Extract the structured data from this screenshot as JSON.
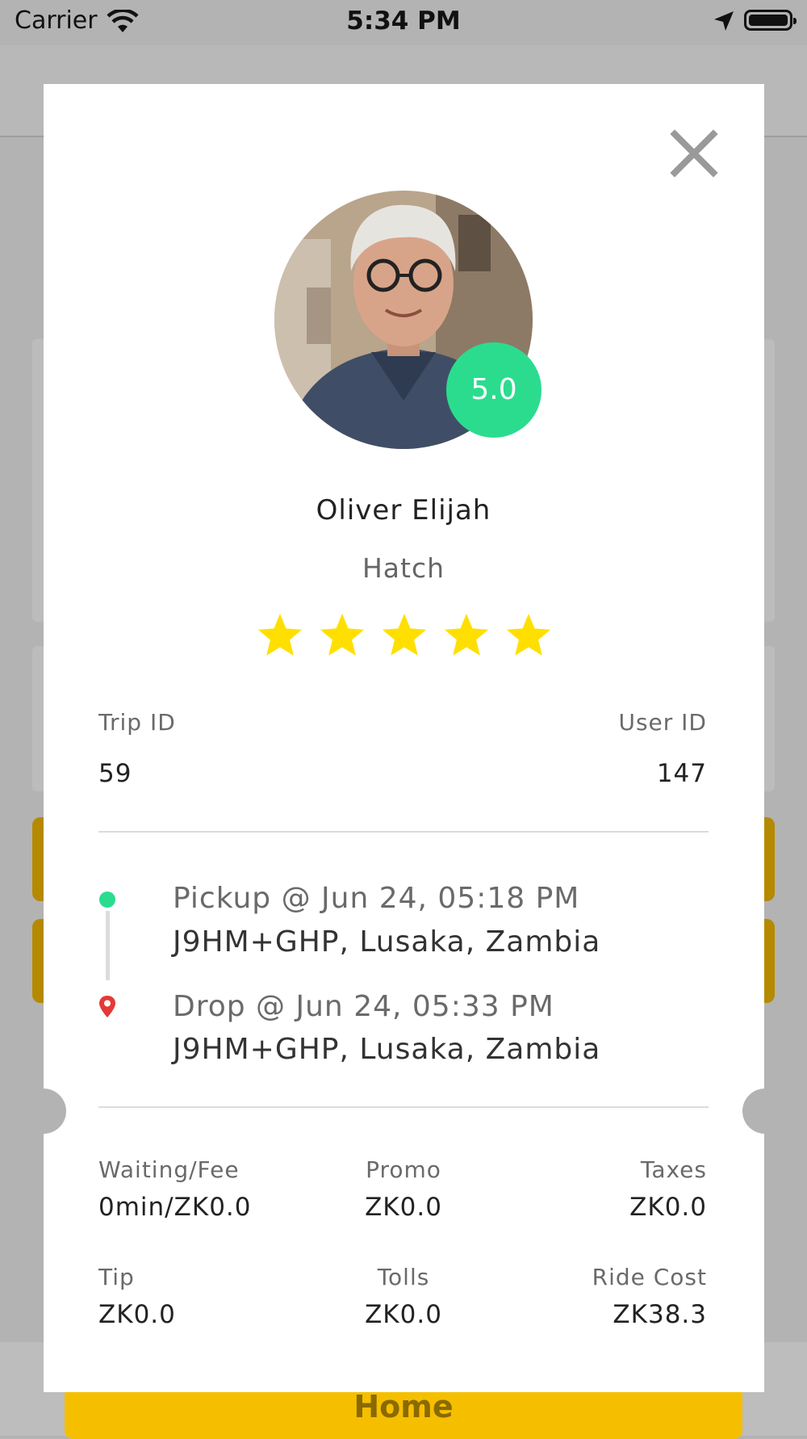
{
  "status_bar": {
    "carrier": "Carrier",
    "time": "5:34 PM"
  },
  "background": {
    "home_button": "Home"
  },
  "modal": {
    "rating": "5.0",
    "driver_name": "Oliver Elijah",
    "vehicle": "Hatch",
    "stars": 5,
    "trip_id_label": "Trip ID",
    "trip_id": "59",
    "user_id_label": "User ID",
    "user_id": "147",
    "pickup": {
      "title": "Pickup @ Jun 24, 05:18 PM",
      "address": "J9HM+GHP, Lusaka, Zambia"
    },
    "drop": {
      "title": "Drop @ Jun 24, 05:33 PM",
      "address": "J9HM+GHP, Lusaka, Zambia"
    },
    "fees": {
      "waiting_label": "Waiting/Fee",
      "waiting_value": "0min/ZK0.0",
      "promo_label": "Promo",
      "promo_value": "ZK0.0",
      "taxes_label": "Taxes",
      "taxes_value": "ZK0.0",
      "tip_label": "Tip",
      "tip_value": "ZK0.0",
      "tolls_label": "Tolls",
      "tolls_value": "ZK0.0",
      "ride_cost_label": "Ride Cost",
      "ride_cost_value": "ZK38.3"
    }
  },
  "colors": {
    "accent_green": "#2bdc8f",
    "star_yellow": "#ffdf00",
    "pin_red": "#e53935",
    "home_yellow": "#f5bf00"
  },
  "icons": [
    "wifi-icon",
    "location-arrow-icon",
    "battery-icon",
    "close-icon",
    "star-icon",
    "drop-pin-icon"
  ]
}
